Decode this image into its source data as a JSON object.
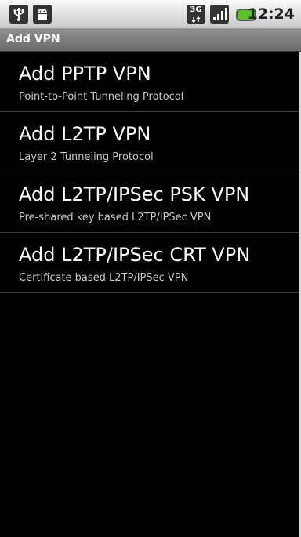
{
  "status_bar": {
    "icons": [
      "usb-icon",
      "android-icon",
      "network-3g-icon",
      "signal-icon",
      "battery-icon"
    ],
    "network_label": "3G",
    "time": "12:24",
    "battery_color": "#5cc22a"
  },
  "title_bar": {
    "title": "Add VPN"
  },
  "vpn_options": [
    {
      "title": "Add PPTP VPN",
      "subtitle": "Point-to-Point Tunneling Protocol"
    },
    {
      "title": "Add L2TP VPN",
      "subtitle": "Layer 2 Tunneling Protocol"
    },
    {
      "title": "Add L2TP/IPSec PSK VPN",
      "subtitle": "Pre-shared key based L2TP/IPSec VPN"
    },
    {
      "title": "Add L2TP/IPSec CRT VPN",
      "subtitle": "Certificate based L2TP/IPSec VPN"
    }
  ]
}
